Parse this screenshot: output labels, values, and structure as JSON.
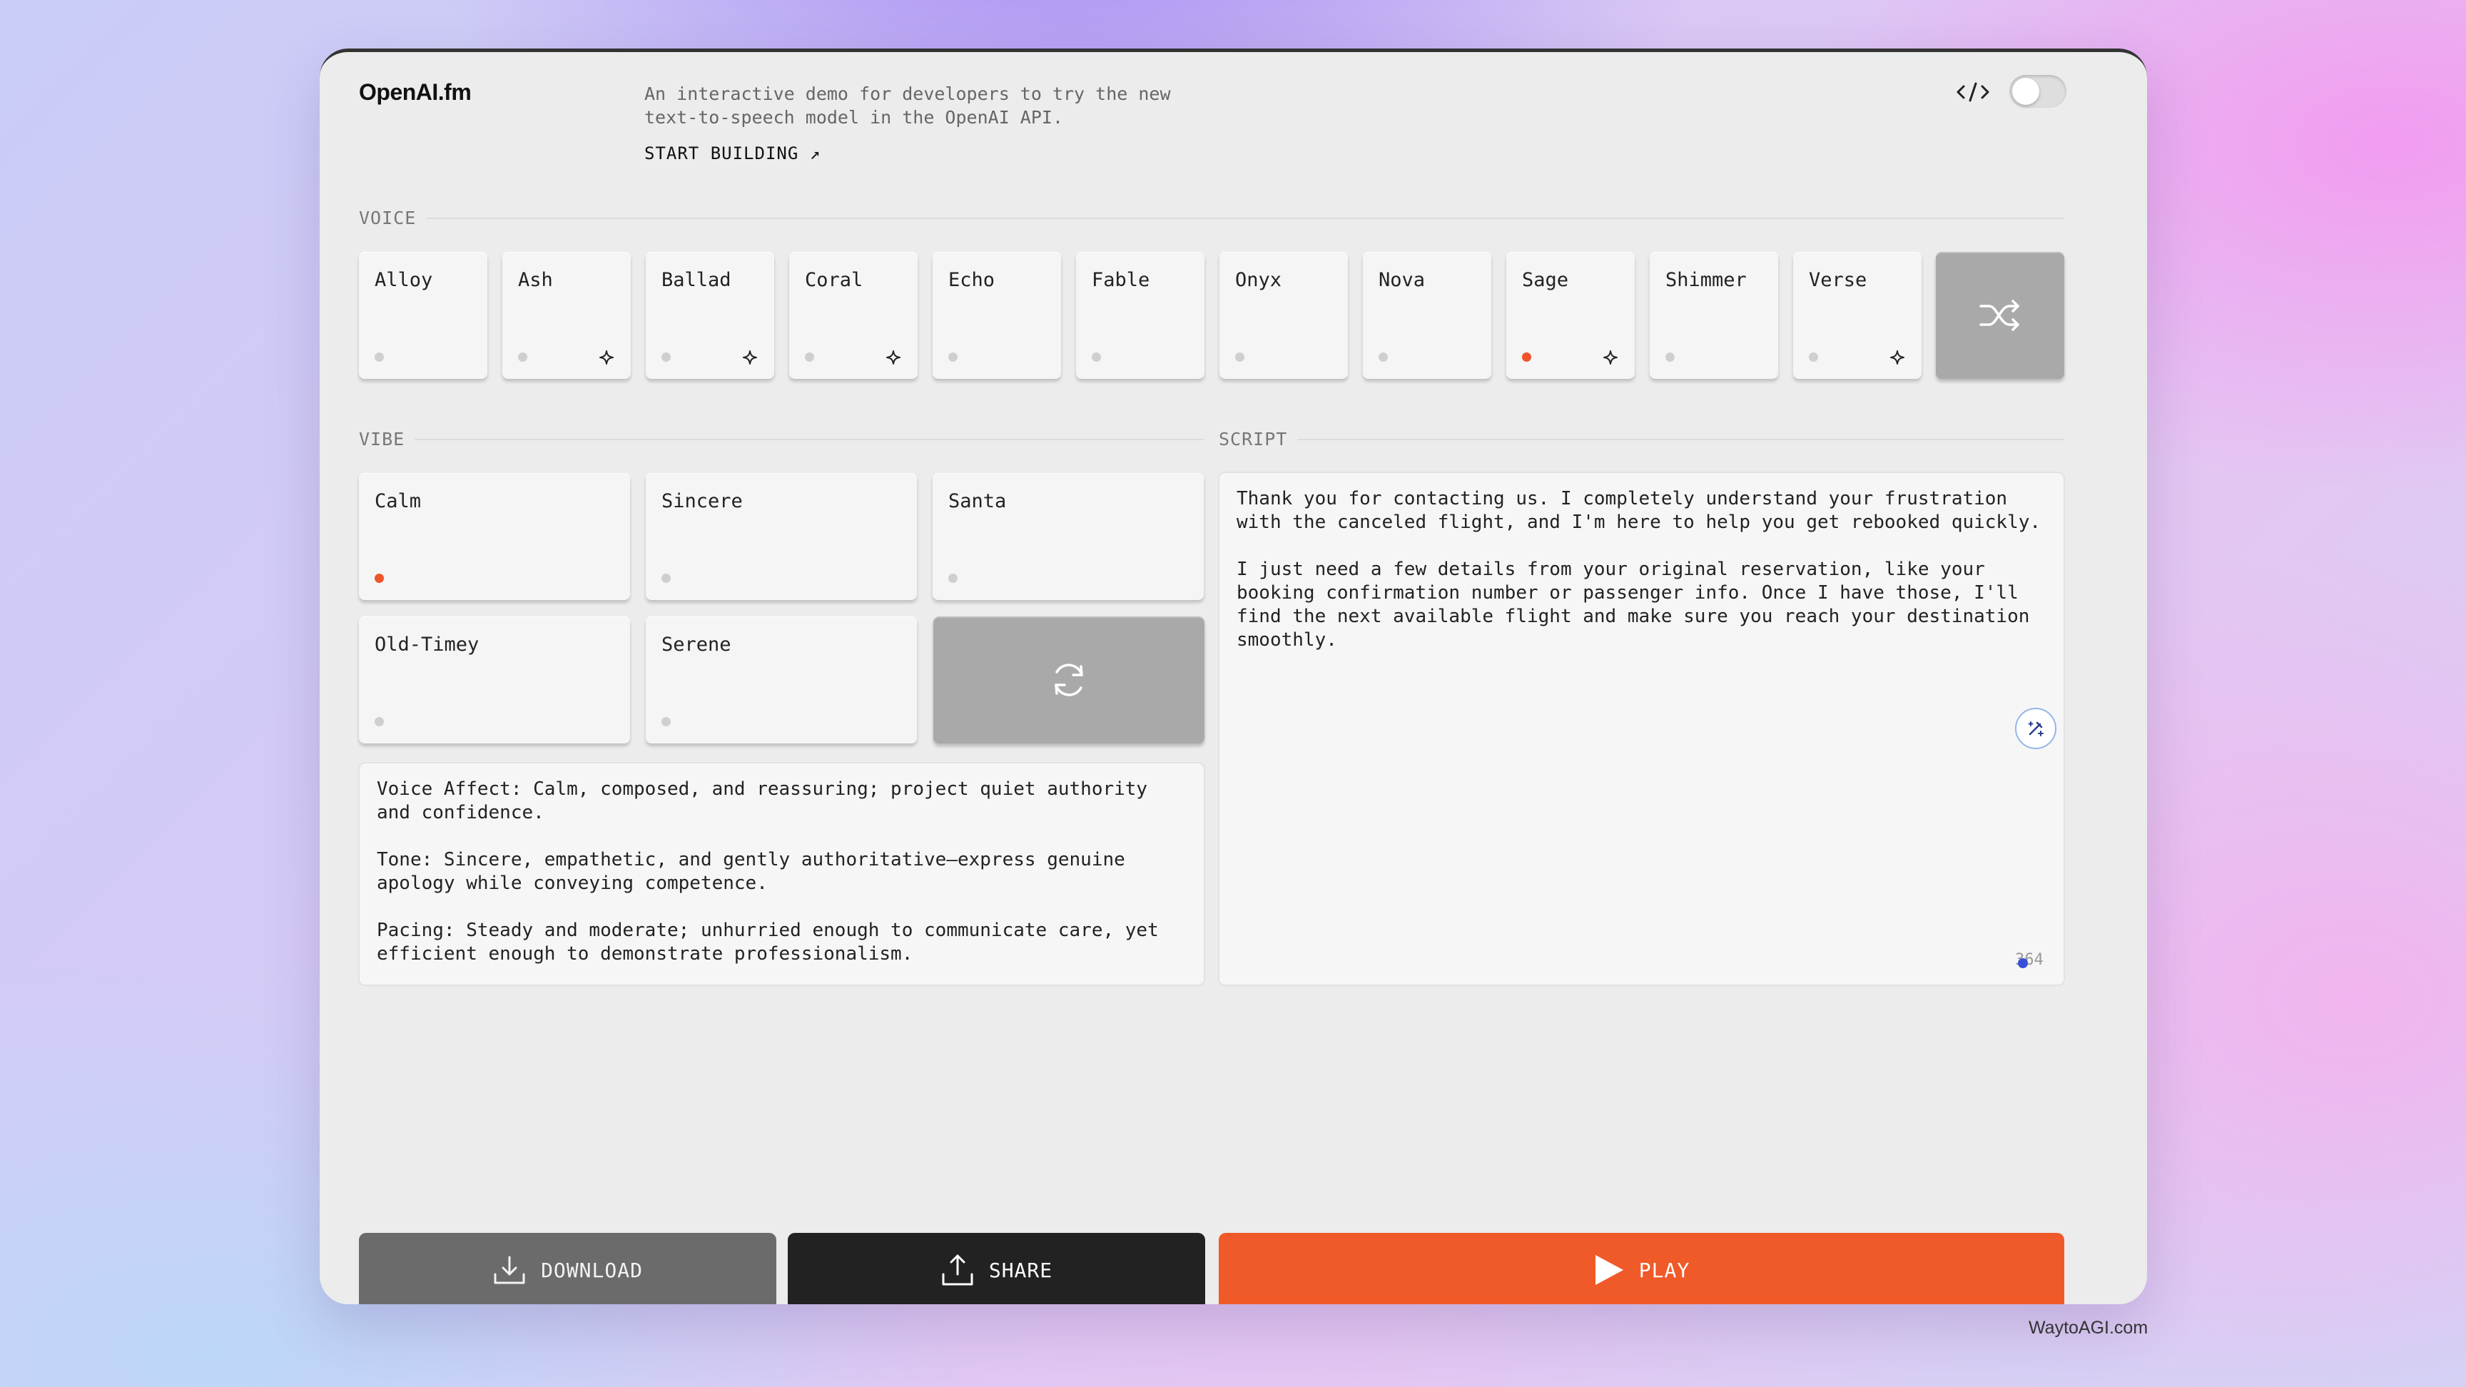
{
  "app": {
    "brand": "OpenAI.fm",
    "tagline": "An interactive demo for developers to try the new text-to-speech model in the OpenAI API.",
    "start_building": "START BUILDING ↗"
  },
  "voice": {
    "label": "VOICE",
    "items": [
      {
        "label": "Alloy",
        "active": false,
        "new": false
      },
      {
        "label": "Ash",
        "active": false,
        "new": true
      },
      {
        "label": "Ballad",
        "active": false,
        "new": true
      },
      {
        "label": "Coral",
        "active": false,
        "new": true
      },
      {
        "label": "Echo",
        "active": false,
        "new": false
      },
      {
        "label": "Fable",
        "active": false,
        "new": false
      },
      {
        "label": "Onyx",
        "active": false,
        "new": false
      },
      {
        "label": "Nova",
        "active": false,
        "new": false
      },
      {
        "label": "Sage",
        "active": true,
        "new": true
      },
      {
        "label": "Shimmer",
        "active": false,
        "new": false
      },
      {
        "label": "Verse",
        "active": false,
        "new": true
      }
    ],
    "shuffle_icon": "shuffle-icon"
  },
  "vibe": {
    "label": "VIBE",
    "items": [
      {
        "label": "Calm",
        "active": true
      },
      {
        "label": "Sincere",
        "active": false
      },
      {
        "label": "Santa",
        "active": false
      },
      {
        "label": "Old-Timey",
        "active": false
      },
      {
        "label": "Serene",
        "active": false
      }
    ],
    "refresh_icon": "refresh-icon",
    "description": "Voice Affect: Calm, composed, and reassuring; project quiet authority and confidence.\n\nTone: Sincere, empathetic, and gently authoritative—express genuine apology while conveying competence.\n\nPacing: Steady and moderate; unhurried enough to communicate care, yet efficient enough to demonstrate professionalism."
  },
  "script": {
    "label": "SCRIPT",
    "text": "Thank you for contacting us. I completely understand your frustration with the canceled flight, and I'm here to help you get rebooked quickly.\n\nI just need a few details from your original reservation, like your booking confirmation number or passenger info. Once I have those, I'll find the next available flight and make sure you reach your destination smoothly.",
    "char_count": "364"
  },
  "actions": {
    "download": "DOWNLOAD",
    "share": "SHARE",
    "play": "PLAY"
  },
  "colors": {
    "accent": "#f05a28",
    "active_dot": "#f0542a"
  },
  "watermark": "WaytoAGI.com"
}
